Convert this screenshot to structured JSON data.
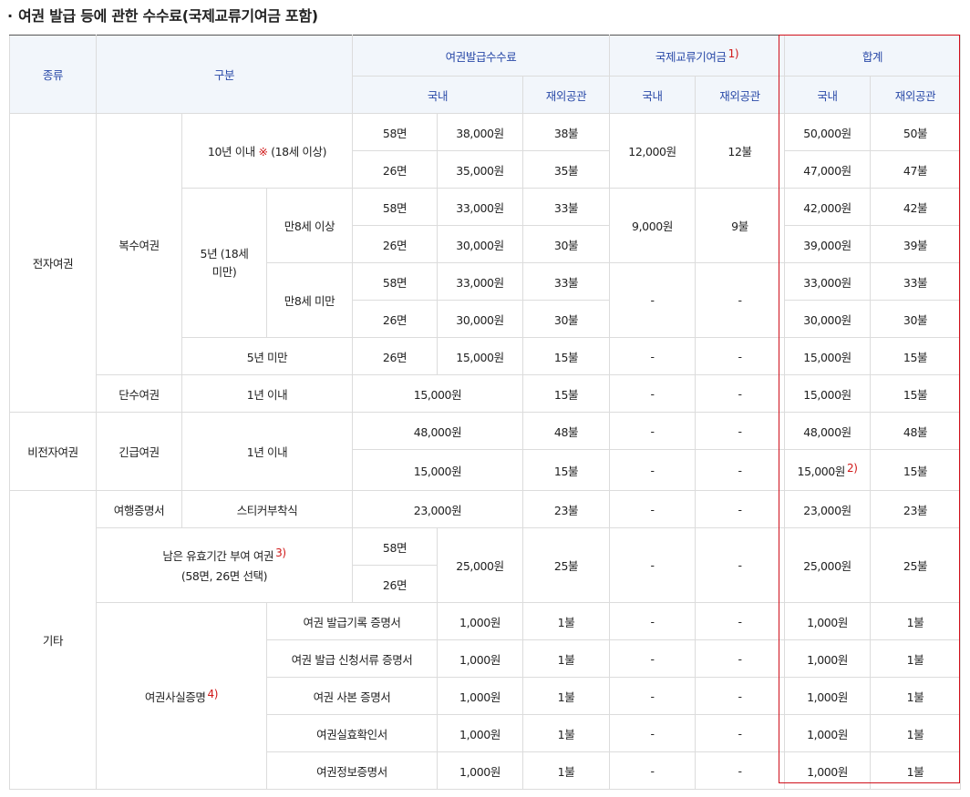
{
  "title": "여권 발급 등에 관한 수수료(국제교류기여금 포함)",
  "header": {
    "kind": "종류",
    "category": "구분",
    "issue_fee": "여권발급수수료",
    "contribution": "국제교류기여금",
    "contribution_note": "1)",
    "total": "합계",
    "domestic": "국내",
    "overseas": "재외공관"
  },
  "common": {
    "dash": "-"
  },
  "rows": {
    "e_passport": "전자여권",
    "multi": "복수여권",
    "ten_years": "10년 이내",
    "ten_years_mark": "※",
    "ten_years_age": "(18세 이상)",
    "five_years_minor": "5년 (18세 미만)",
    "age8_over": "만8세 이상",
    "age8_under": "만8세 미만",
    "under5": "5년 미만",
    "single": "단수여권",
    "within1": "1년 이내",
    "non_e": "비전자여권",
    "emergency": "긴급여권",
    "other": "기타",
    "travel_cert": "여행증명서",
    "sticker": "스티커부착식",
    "remaining_validity": "남은 유효기간 부여 여권",
    "remaining_note": "3)",
    "remaining_sub": "(58면, 26면 선택)",
    "fact_cert": "여권사실증명",
    "fact_note": "4)",
    "c1": "여권 발급기록 증명서",
    "c2": "여권 발급 신청서류 증명서",
    "c3": "여권 사본 증명서",
    "c4": "여권실효확인서",
    "c5": "여권정보증명서",
    "p58": "58면",
    "p26": "26면",
    "note2": "2)"
  },
  "values": {
    "r1": {
      "dom": "38,000원",
      "ovs": "38불",
      "tdom": "50,000원",
      "tovs": "50불"
    },
    "r2": {
      "dom": "35,000원",
      "ovs": "35불",
      "tdom": "47,000원",
      "tovs": "47불"
    },
    "c10": {
      "dom": "12,000원",
      "ovs": "12불"
    },
    "r3": {
      "dom": "33,000원",
      "ovs": "33불",
      "tdom": "42,000원",
      "tovs": "42불"
    },
    "r4": {
      "dom": "30,000원",
      "ovs": "30불",
      "tdom": "39,000원",
      "tovs": "39불"
    },
    "c5y": {
      "dom": "9,000원",
      "ovs": "9불"
    },
    "r5": {
      "dom": "33,000원",
      "ovs": "33불",
      "tdom": "33,000원",
      "tovs": "33불"
    },
    "r6": {
      "dom": "30,000원",
      "ovs": "30불",
      "tdom": "30,000원",
      "tovs": "30불"
    },
    "r7": {
      "dom": "15,000원",
      "ovs": "15불",
      "tdom": "15,000원",
      "tovs": "15불"
    },
    "r8": {
      "fee": "15,000원",
      "ovs": "15불",
      "tdom": "15,000원",
      "tovs": "15불"
    },
    "r9": {
      "fee": "48,000원",
      "ovs": "48불",
      "tdom": "48,000원",
      "tovs": "48불"
    },
    "r10": {
      "fee": "15,000원",
      "ovs": "15불",
      "tdom": "15,000원",
      "tovs": "15불"
    },
    "r11": {
      "fee": "23,000원",
      "ovs": "23불",
      "tdom": "23,000원",
      "tovs": "23불"
    },
    "r12": {
      "dom": "25,000원",
      "ovs": "25불",
      "tdom": "25,000원",
      "tovs": "25불"
    },
    "cert": {
      "dom": "1,000원",
      "ovs": "1불",
      "tdom": "1,000원",
      "tovs": "1불"
    }
  }
}
